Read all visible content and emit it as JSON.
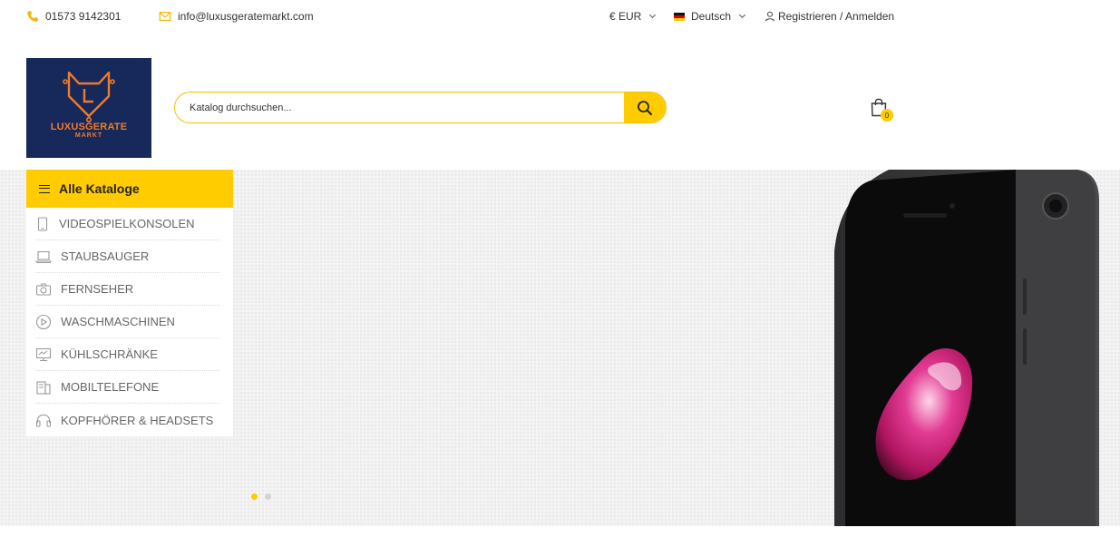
{
  "topbar": {
    "phone": "01573 9142301",
    "email": "info@luxusgeratemarkt.com",
    "currency": "€ EUR",
    "language": "Deutsch",
    "account": "Registrieren / Anmelden"
  },
  "logo": {
    "line1": "LUXUSGERATE",
    "line2": "MARKT"
  },
  "search": {
    "placeholder": "Katalog durchsuchen..."
  },
  "cart": {
    "count": "0"
  },
  "menu": {
    "title": "Alle Kataloge",
    "items": [
      {
        "label": "VIDEOSPIELKONSOLEN",
        "icon": "tablet-icon"
      },
      {
        "label": "STAUBSAUGER",
        "icon": "laptop-icon"
      },
      {
        "label": "FERNSEHER",
        "icon": "camera-icon"
      },
      {
        "label": "WASCHMASCHINEN",
        "icon": "play-icon"
      },
      {
        "label": "KÜHLSCHRÄNKE",
        "icon": "monitor-icon"
      },
      {
        "label": "MOBILTELEFONE",
        "icon": "phone-device-icon"
      },
      {
        "label": "KOPFHÖRER & HEADSETS",
        "icon": "headphones-icon"
      }
    ]
  },
  "colors": {
    "accent": "#ffcc00",
    "logo_bg": "#17285a",
    "logo_fg": "#f07b2b"
  }
}
